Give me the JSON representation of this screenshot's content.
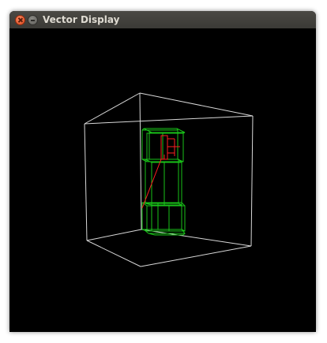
{
  "window": {
    "title": "Vector Display",
    "buttons": [
      {
        "name": "close",
        "icon": "close-icon",
        "color": "#e1491b"
      },
      {
        "name": "minimize",
        "icon": "minimize-icon",
        "color": "#6a6964"
      }
    ]
  },
  "display": {
    "background": "#000000",
    "colors": {
      "cube": "#d8d8d8",
      "model": "#19c219",
      "highlight": "#ff2020"
    }
  }
}
